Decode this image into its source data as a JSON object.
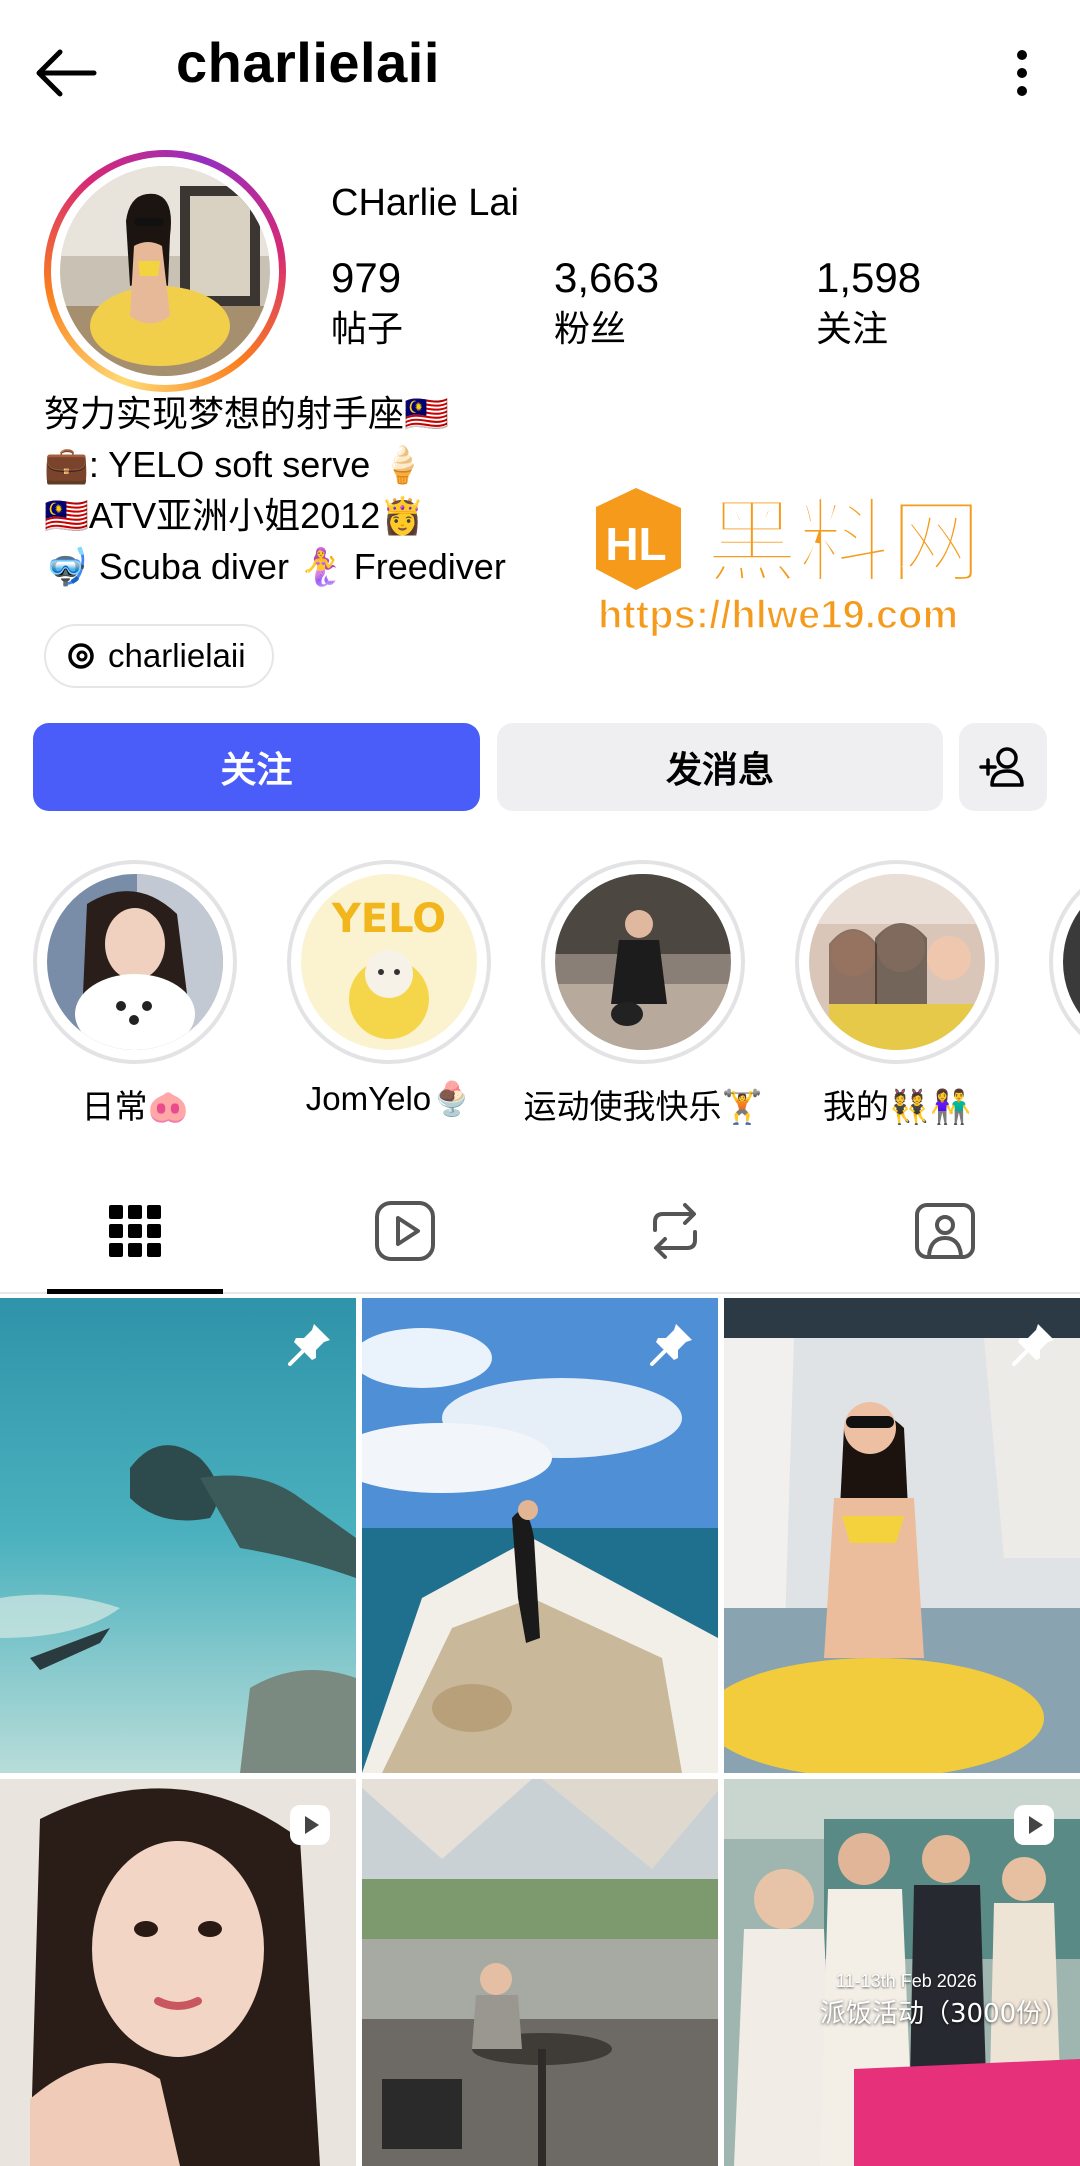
{
  "header": {
    "username": "charlielaii"
  },
  "profile": {
    "display_name": "CHarlie Lai",
    "stats": [
      {
        "value": "979",
        "label": "帖子"
      },
      {
        "value": "3,663",
        "label": "粉丝"
      },
      {
        "value": "1,598",
        "label": "关注"
      }
    ],
    "bio": [
      "努力实现梦想的射手座🇲🇾",
      "💼: YELO soft serve 🍦",
      "🇲🇾ATV亚洲小姐2012👸",
      "🤿 Scuba diver 🧜‍♀️ Freediver"
    ],
    "threads_handle": "charlielaii"
  },
  "watermark": {
    "logo_text": "黑料网",
    "url": "https://hlwe19.com"
  },
  "actions": {
    "follow_label": "关注",
    "message_label": "发消息"
  },
  "highlights": [
    {
      "label": "日常🐽"
    },
    {
      "label": "JomYelo🍨"
    },
    {
      "label": "运动使我快乐🏋️"
    },
    {
      "label": "我的👯👫"
    }
  ],
  "tabs": [
    {
      "icon": "grid-icon",
      "active": true
    },
    {
      "icon": "reels-icon",
      "active": false
    },
    {
      "icon": "reposts-icon",
      "active": false
    },
    {
      "icon": "tagged-icon",
      "active": false
    }
  ],
  "posts": [
    {
      "badge": "pin-icon",
      "caption": ""
    },
    {
      "badge": "pin-icon",
      "caption": ""
    },
    {
      "badge": "pin-icon",
      "caption": ""
    },
    {
      "badge": "reel-icon",
      "caption": ""
    },
    {
      "badge": "",
      "caption": ""
    },
    {
      "badge": "reel-icon",
      "overlay_date": "11-13th Feb 2026",
      "overlay_text": "派饭活动（3000份）"
    }
  ],
  "colors": {
    "follow_button": "#4a5df9",
    "secondary_button": "#efeff1",
    "watermark_orange": "#f59a1b"
  }
}
